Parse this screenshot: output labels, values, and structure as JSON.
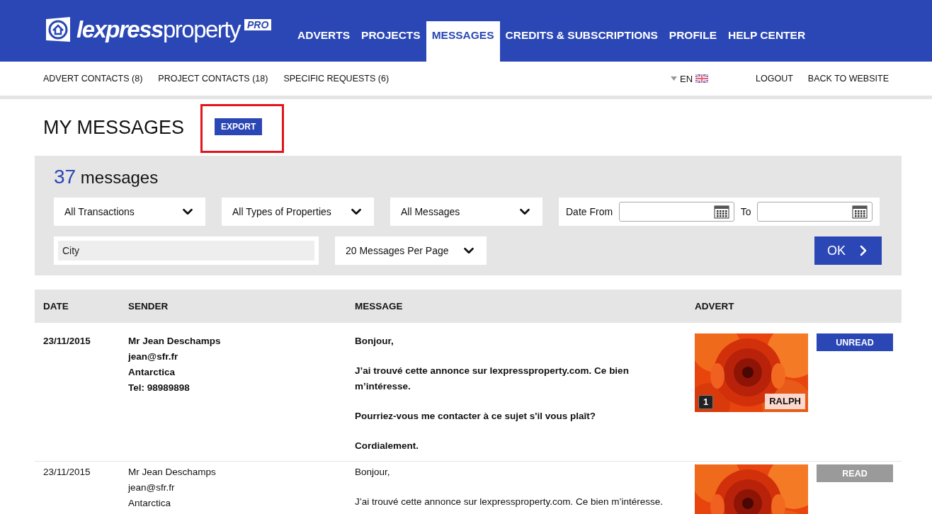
{
  "logo": {
    "bold": "lexpress",
    "light": "property",
    "badge": "PRO"
  },
  "nav": [
    {
      "label": "ADVERTS",
      "selected": false
    },
    {
      "label": "PROJECTS",
      "selected": false
    },
    {
      "label": "MESSAGES",
      "selected": true
    },
    {
      "label": "CREDITS & SUBSCRIPTIONS",
      "selected": false
    },
    {
      "label": "PROFILE",
      "selected": false
    },
    {
      "label": "HELP CENTER",
      "selected": false
    }
  ],
  "subnav": [
    "ADVERT CONTACTS (8)",
    "PROJECT CONTACTS (18)",
    "SPECIFIC REQUESTS (6)"
  ],
  "language": "EN",
  "account_links": [
    "LOGOUT",
    "BACK TO WEBSITE"
  ],
  "page_title": "MY MESSAGES",
  "export_button": {
    "label": "EXPORT",
    "highlighted": true
  },
  "filters": {
    "count": "37",
    "count_label": "messages",
    "selects": [
      "All Transactions",
      "All Types of Properties",
      "All Messages"
    ],
    "date_from_label": "Date From",
    "date_to_label": "To",
    "city": {
      "placeholder": "City"
    },
    "per_page": "20 Messages Per Page",
    "ok": "OK"
  },
  "table": {
    "columns": [
      "DATE",
      "SENDER",
      "MESSAGE",
      "ADVERT"
    ],
    "rows": [
      {
        "date": "23/11/2015",
        "sender": [
          "Mr Jean Deschamps",
          "jean@sfr.fr",
          "Antarctica",
          "Tel: 98989898"
        ],
        "message": [
          "Bonjour,",
          "J’ai trouvé cette annonce sur lexpressproperty.com. Ce bien m’intéresse.",
          "Pourriez-vous me contacter à ce sujet s'il vous plaît?",
          "Cordialement."
        ],
        "advert": {
          "kind": "picture",
          "photo_count": "1",
          "agent": "RALPH"
        },
        "status": "UNREAD",
        "read": false
      },
      {
        "date": "23/11/2015",
        "sender": [
          "Mr Jean Deschamps",
          "jean@sfr.fr",
          "Antarctica"
        ],
        "message": [
          "Bonjour,",
          "J’ai trouvé cette annonce sur lexpressproperty.com. Ce bien m’intéresse."
        ],
        "advert": {
          "kind": "picture"
        },
        "status": "READ",
        "read": true
      }
    ]
  }
}
